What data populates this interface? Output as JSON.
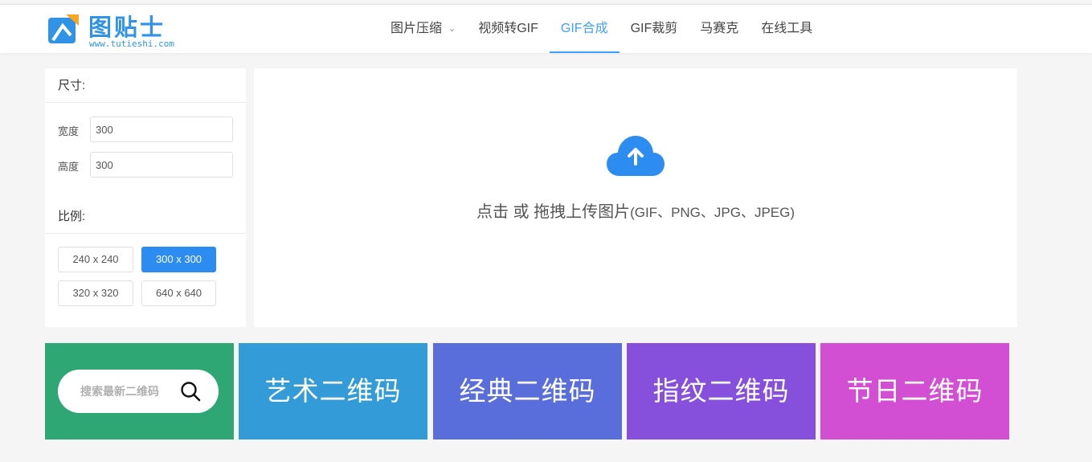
{
  "brand": {
    "title": "图贴士",
    "url": "www.tutieshi.com",
    "color": "#3193e5"
  },
  "nav": {
    "items": [
      {
        "label": "图片压缩",
        "has_dropdown": true,
        "active": false
      },
      {
        "label": "视频转GIF",
        "active": false
      },
      {
        "label": "GIF合成",
        "active": true
      },
      {
        "label": "GIF裁剪",
        "active": false
      },
      {
        "label": "马赛克",
        "active": false
      },
      {
        "label": "在线工具",
        "active": false
      }
    ]
  },
  "size_panel": {
    "size_title": "尺寸:",
    "width_label": "宽度",
    "width_value": "300",
    "height_label": "高度",
    "height_value": "300",
    "ratio_title": "比例:",
    "ratios": [
      "240 x 240",
      "300 x 300",
      "320 x 320",
      "640 x 640"
    ],
    "selected_ratio": "300 x 300"
  },
  "upload": {
    "icon": "cloud-upload-icon",
    "text_main": "点击 或 拖拽上传图片",
    "text_formats": "(GIF、PNG、JPG、JPEG)"
  },
  "banners": {
    "search_placeholder": "搜索最新二维码",
    "items": [
      {
        "label": "艺术二维码",
        "color": "#329bd8"
      },
      {
        "label": "经典二维码",
        "color": "#5a6edb"
      },
      {
        "label": "指纹二维码",
        "color": "#8750dc"
      },
      {
        "label": "节日二维码",
        "color": "#d24ed2"
      }
    ],
    "search_bg": "#2fa775"
  },
  "colors": {
    "accent": "#409eff",
    "button_active": "#2d8cf0"
  }
}
